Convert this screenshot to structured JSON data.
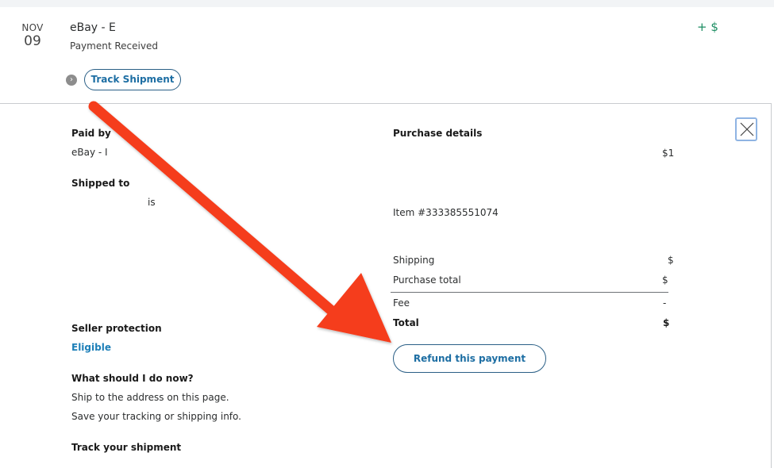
{
  "activity": {
    "date_month": "NOV",
    "date_day": "09",
    "merchant": "eBay - E",
    "status": "Payment Received",
    "amount": "+ $",
    "track_button": "Track Shipment"
  },
  "details": {
    "paid_by_label": "Paid by",
    "paid_by_value": "eBay - I",
    "shipped_to_label": "Shipped to",
    "shipped_to_value": "is",
    "seller_protection_label": "Seller protection",
    "seller_protection_value": "Eligible",
    "what_now_label": "What should I do now?",
    "what_now_steps": [
      "Ship to the address on this page.",
      "Save your tracking or shipping info."
    ],
    "track_label": "Track your shipment"
  },
  "purchase": {
    "title": "Purchase details",
    "item_price": "$1",
    "item_number": "Item #333385551074",
    "rows": [
      {
        "label": "Shipping",
        "value": "$"
      },
      {
        "label": "Purchase total",
        "value": "$"
      },
      {
        "label": "Fee",
        "value": "-"
      },
      {
        "label": "Total",
        "value": "$"
      }
    ],
    "refund_button": "Refund this payment"
  },
  "colors": {
    "accent_blue": "#1d6ea3",
    "positive_green": "#1c8d62",
    "annotation_red": "#f53c1e"
  }
}
